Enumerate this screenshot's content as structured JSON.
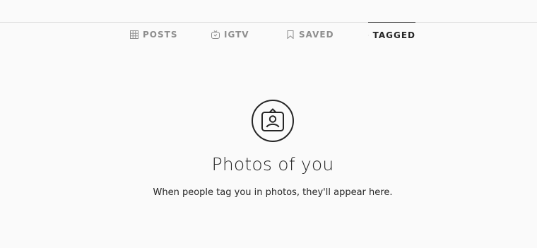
{
  "tabs": [
    {
      "label": "POSTS",
      "icon": "grid-icon",
      "active": false
    },
    {
      "label": "IGTV",
      "icon": "igtv-icon",
      "active": false
    },
    {
      "label": "SAVED",
      "icon": "bookmark-icon",
      "active": false
    },
    {
      "label": "TAGGED",
      "icon": "tagged-icon",
      "active": true
    }
  ],
  "empty_state": {
    "icon": "tagged-user-icon",
    "title": "Photos of you",
    "subtitle": "When people tag you in photos, they'll appear here."
  },
  "colors": {
    "background": "#fafafa",
    "active_text": "#262626",
    "inactive_text": "#8e8e8e",
    "divider": "#dbdbdb"
  }
}
